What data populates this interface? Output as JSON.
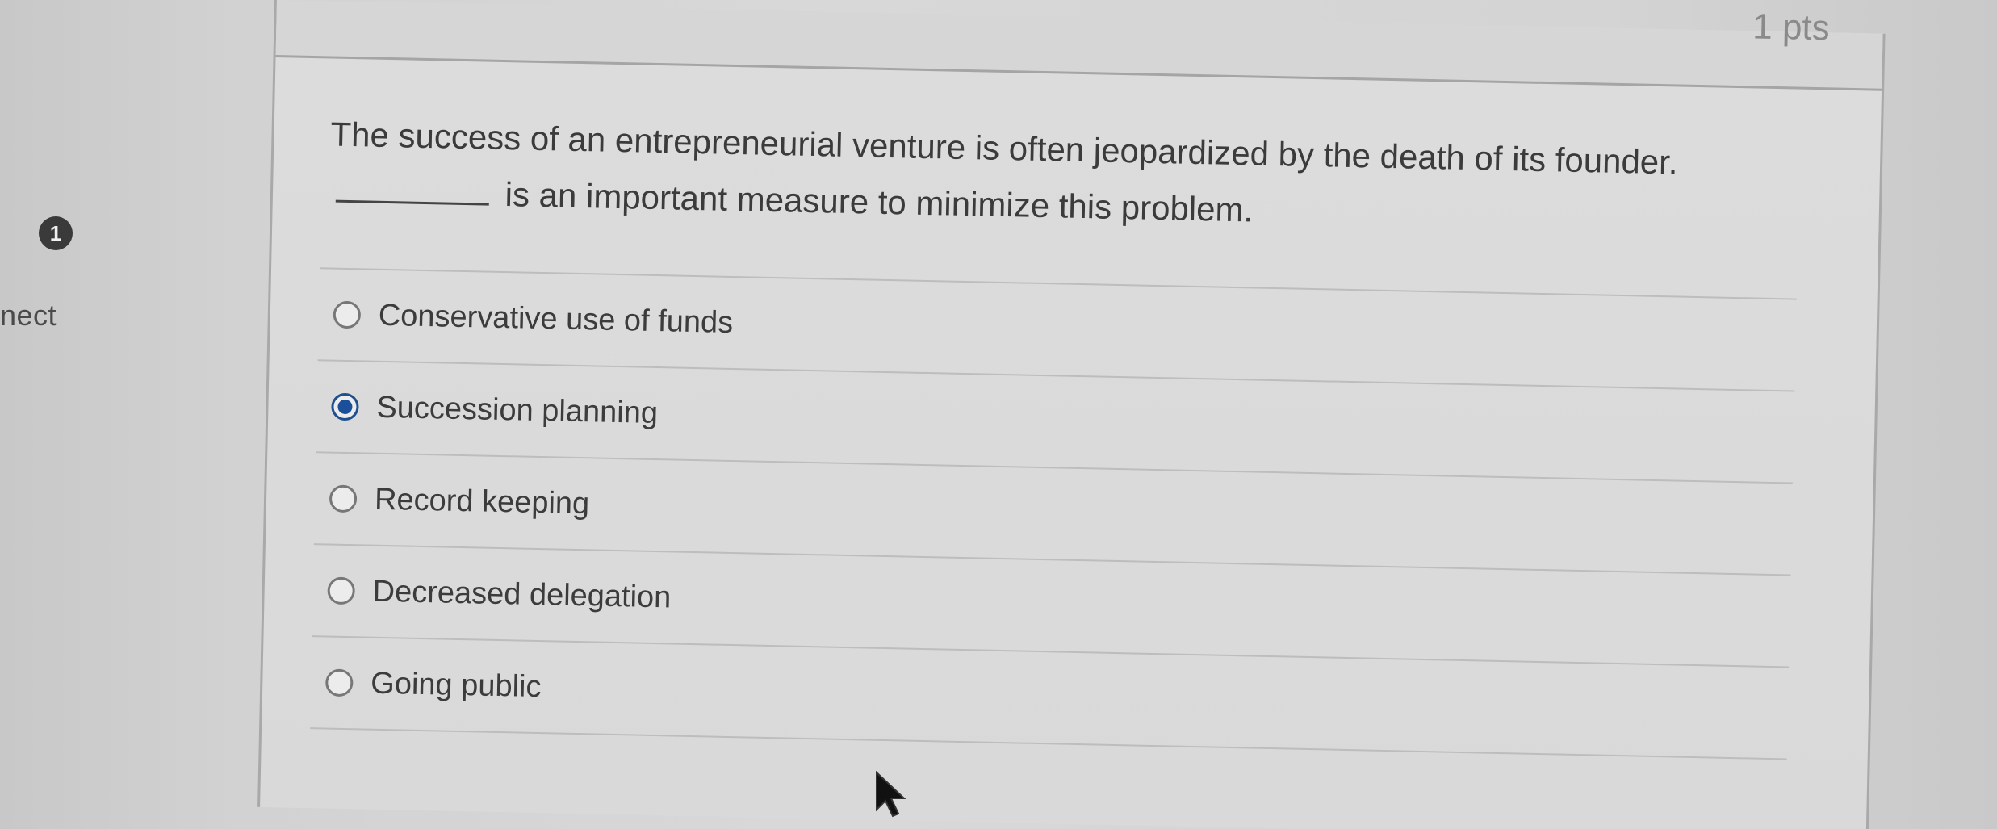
{
  "header": {
    "points_label": "1 pts"
  },
  "gutter": {
    "question_number": "1",
    "status_text": "nect"
  },
  "question": {
    "text_part1": "The success of an entrepreneurial venture is often jeopardized by the death of its founder.",
    "text_part2": "is an important measure to minimize this problem."
  },
  "answers": [
    {
      "label": "Conservative use of funds",
      "selected": false
    },
    {
      "label": "Succession planning",
      "selected": true
    },
    {
      "label": "Record keeping",
      "selected": false
    },
    {
      "label": "Decreased delegation",
      "selected": false
    },
    {
      "label": "Going public",
      "selected": false
    }
  ],
  "colors": {
    "selected_radio": "#1b4f99",
    "text": "#3b3b3b"
  },
  "icons": {
    "cursor": "mouse-pointer-icon"
  }
}
